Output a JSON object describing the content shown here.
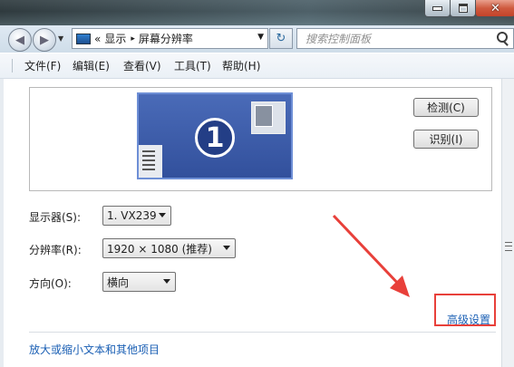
{
  "window": {
    "controls": {
      "minimize": "minimize-icon",
      "maximize": "maximize-icon",
      "close": "close-icon"
    }
  },
  "address": {
    "prefix": "«",
    "crumbs": [
      "显示",
      "屏幕分辨率"
    ],
    "separator": "▸",
    "search_placeholder": "搜索控制面板"
  },
  "menu": {
    "items": [
      "文件(F)",
      "编辑(E)",
      "查看(V)",
      "工具(T)",
      "帮助(H)"
    ]
  },
  "preview": {
    "monitor_number": "1",
    "detect_label": "检测(C)",
    "identify_label": "识别(I)"
  },
  "settings": {
    "display_label": "显示器(S):",
    "display_value": "1. VX239",
    "resolution_label": "分辨率(R):",
    "resolution_value": "1920 × 1080 (推荐)",
    "orientation_label": "方向(O):",
    "orientation_value": "横向",
    "advanced_link": "高级设置"
  },
  "links": {
    "text_size": "放大或缩小文本和其他项目"
  },
  "colors": {
    "monitor_fill": "#3d5caa",
    "link": "#1a5fb4",
    "highlight": "#e8403a"
  }
}
